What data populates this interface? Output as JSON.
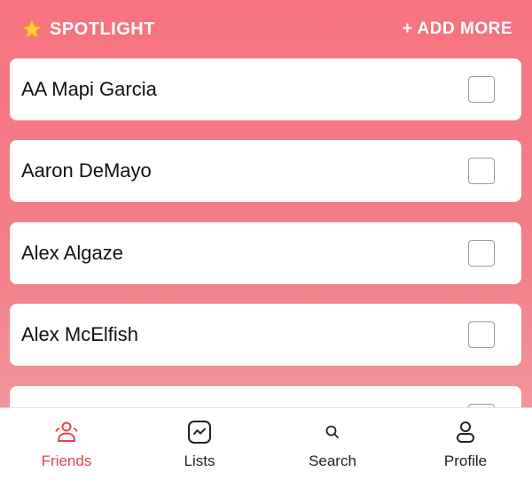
{
  "header": {
    "spotlight_label": "SPOTLIGHT",
    "add_more_label": "+ ADD MORE"
  },
  "friends": [
    {
      "name": "AA Mapi Garcia",
      "checked": false
    },
    {
      "name": "Aaron DeMayo",
      "checked": false
    },
    {
      "name": "Alex Algaze",
      "checked": false
    },
    {
      "name": "Alex McElfish",
      "checked": false
    },
    {
      "name": "",
      "checked": false
    }
  ],
  "tabs": [
    {
      "label": "Friends",
      "icon": "friends-icon",
      "active": true
    },
    {
      "label": "Lists",
      "icon": "lists-icon",
      "active": false
    },
    {
      "label": "Search",
      "icon": "search-icon",
      "active": false
    },
    {
      "label": "Profile",
      "icon": "profile-icon",
      "active": false
    }
  ],
  "colors": {
    "accent": "#e8404f",
    "background_top": "#f7737f",
    "background_bottom": "#f3a2a6"
  }
}
